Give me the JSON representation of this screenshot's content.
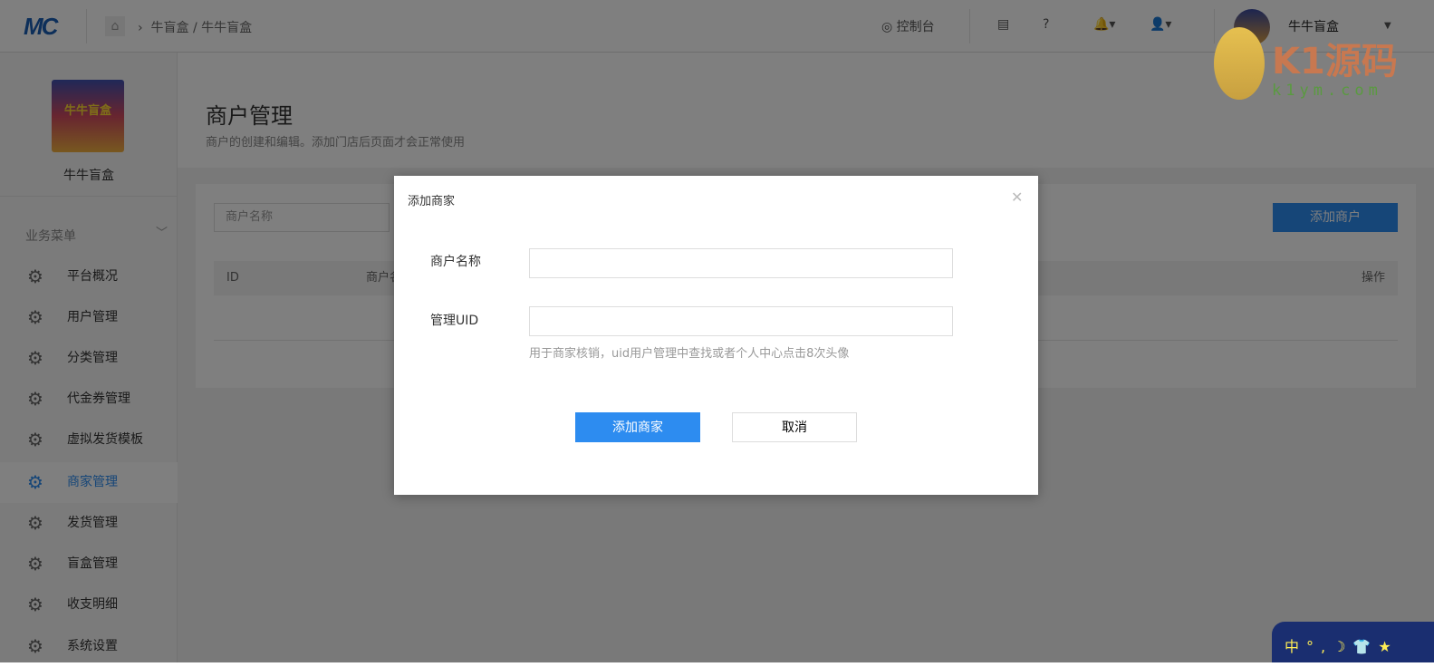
{
  "header": {
    "logo": "MC",
    "breadcrumb": "牛盲盒 / 牛牛盲盒",
    "console": "控制台",
    "shop_icon": "store-icon",
    "help_icon": "question-icon",
    "bell_icon": "bell-icon",
    "user_icon": "user-icon",
    "username": "牛牛盲盒"
  },
  "sidebar": {
    "name": "牛牛盲盒",
    "avatar_text": "牛牛盲盒",
    "menu_title": "业务菜单",
    "items": [
      {
        "label": "平台概况"
      },
      {
        "label": "用户管理"
      },
      {
        "label": "分类管理"
      },
      {
        "label": "代金券管理"
      },
      {
        "label": "虚拟发货模板"
      },
      {
        "label": "商家管理",
        "active": true
      },
      {
        "label": "发货管理"
      },
      {
        "label": "盲盒管理"
      },
      {
        "label": "收支明细"
      },
      {
        "label": "系统设置"
      }
    ]
  },
  "main": {
    "title": "商户管理",
    "subtitle": "商户的创建和编辑。添加门店后页面才会正常使用",
    "search_placeholder": "商户名称",
    "add_button": "添加商户",
    "columns": [
      "ID",
      "商户名",
      "操作"
    ]
  },
  "watermark": {
    "text": "K1源码",
    "url": "k1ym.com"
  },
  "modal": {
    "title": "添加商家",
    "name_label": "商户名称",
    "name_value": "",
    "uid_label": "管理UID",
    "uid_value": "",
    "hint": "用于商家核销，uid用户管理中查找或者个人中心点击8次头像",
    "ok": "添加商家",
    "cancel": "取消"
  },
  "ime": {
    "text": "中°,☽👕★"
  },
  "colors": {
    "primary": "#2d8cf0",
    "overlay": "rgba(0,0,0,0.5)"
  }
}
